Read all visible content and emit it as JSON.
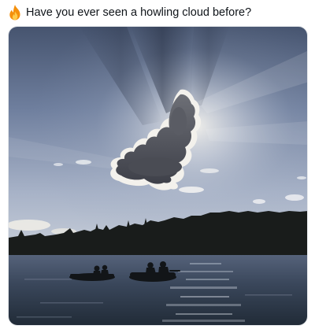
{
  "post": {
    "icon": "fire-icon",
    "text": "Have you ever seen a howling cloud before?"
  },
  "photo": {
    "subject": "silhouetted-cloud-sunbeams-lake-boats",
    "colors": {
      "sky_top": "#4a5a78",
      "sky_mid": "#8e9cb8",
      "sky_low": "#c8cfdc",
      "glow": "#f4f2ee",
      "treeline": "#1a1d1c",
      "water": "#2e3c4e",
      "water_light": "#a9b3c2"
    }
  }
}
